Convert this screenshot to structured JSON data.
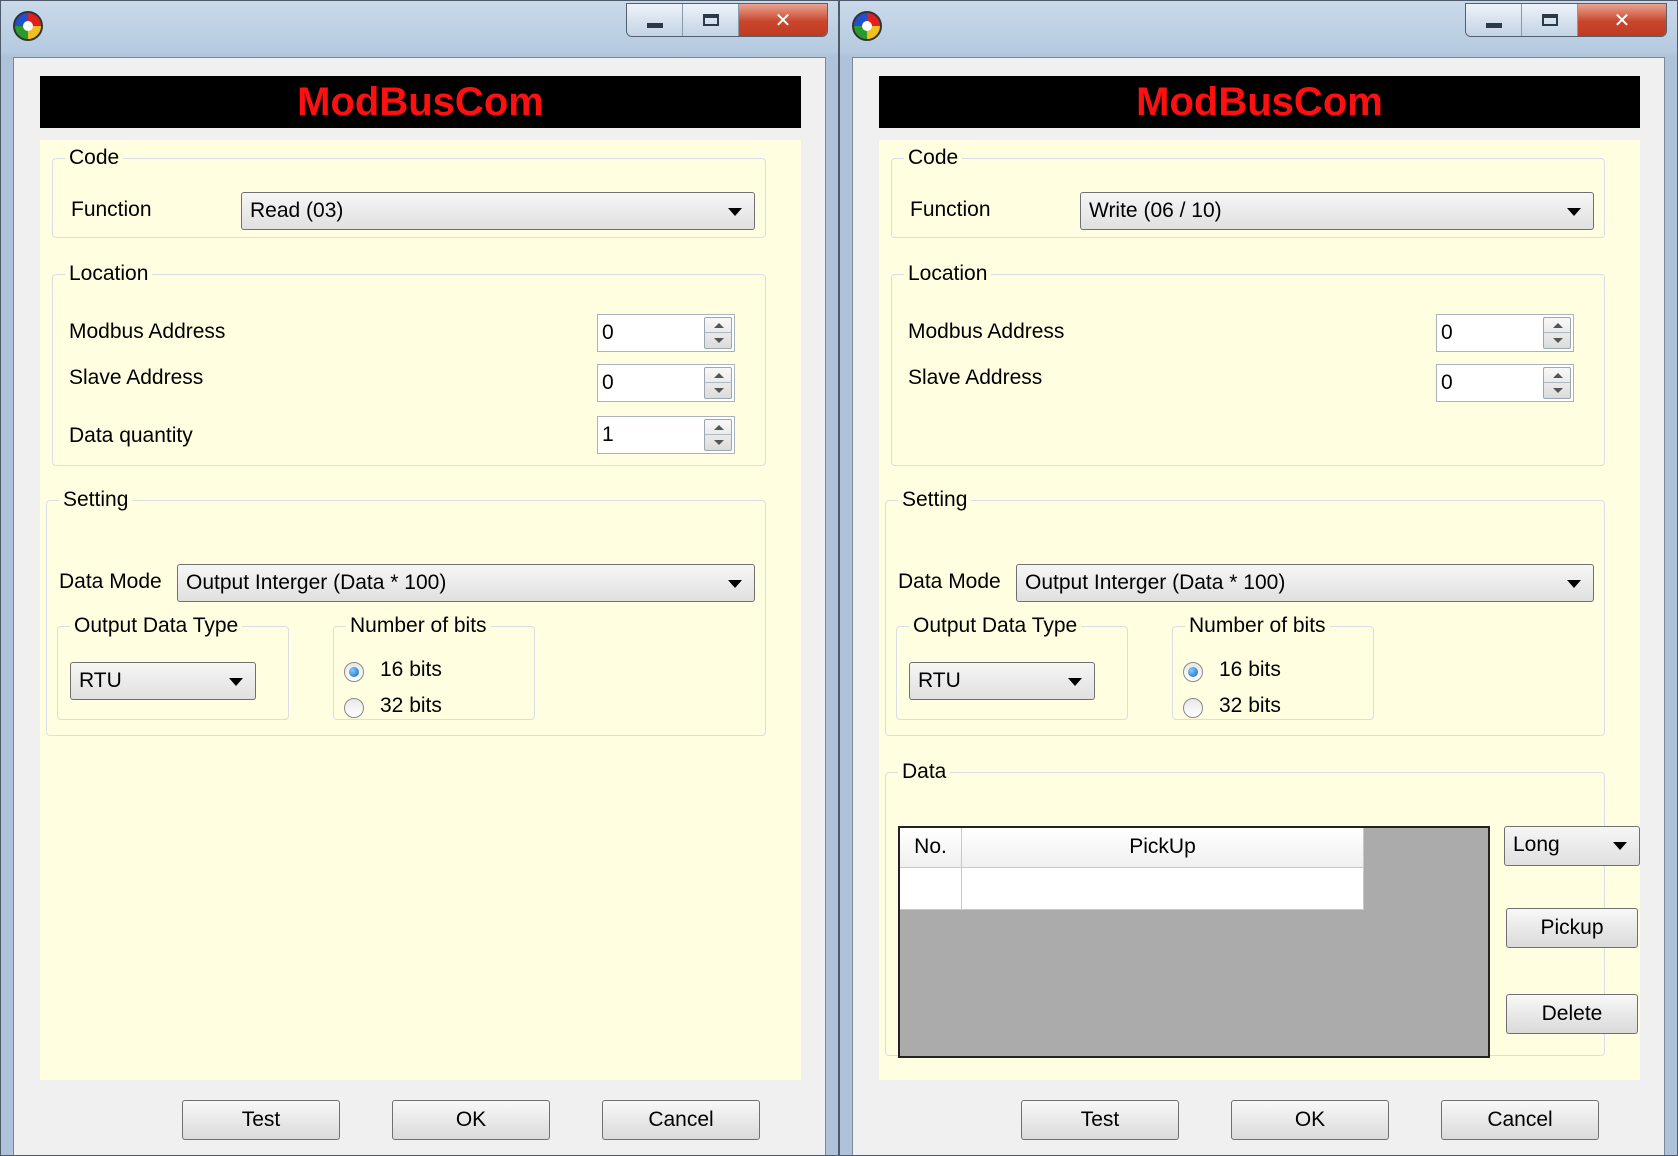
{
  "windows": [
    {
      "banner_title": "ModBusCom",
      "code": {
        "legend": "Code",
        "function_label": "Function",
        "function_value": "Read (03)"
      },
      "location": {
        "legend": "Location",
        "fields": [
          {
            "label": "Modbus Address",
            "value": "0"
          },
          {
            "label": "Slave Address",
            "value": "0"
          },
          {
            "label": "Data quantity",
            "value": "1"
          }
        ]
      },
      "setting": {
        "legend": "Setting",
        "data_mode_label": "Data Mode",
        "data_mode_value": "Output Interger (Data * 100)",
        "output_type_legend": "Output Data Type",
        "output_type_value": "RTU",
        "bits_legend": "Number of bits",
        "bits_options": [
          {
            "label": "16 bits",
            "selected": true
          },
          {
            "label": "32 bits",
            "selected": false
          }
        ]
      },
      "buttons": {
        "test": "Test",
        "ok": "OK",
        "cancel": "Cancel"
      }
    },
    {
      "banner_title": "ModBusCom",
      "code": {
        "legend": "Code",
        "function_label": "Function",
        "function_value": "Write (06 / 10)"
      },
      "location": {
        "legend": "Location",
        "fields": [
          {
            "label": "Modbus Address",
            "value": "0"
          },
          {
            "label": "Slave Address",
            "value": "0"
          }
        ]
      },
      "setting": {
        "legend": "Setting",
        "data_mode_label": "Data Mode",
        "data_mode_value": "Output Interger (Data * 100)",
        "output_type_legend": "Output Data Type",
        "output_type_value": "RTU",
        "bits_legend": "Number of bits",
        "bits_options": [
          {
            "label": "16 bits",
            "selected": true
          },
          {
            "label": "32 bits",
            "selected": false
          }
        ]
      },
      "data": {
        "legend": "Data",
        "columns": [
          "No.",
          "PickUp"
        ],
        "type_value": "Long",
        "pickup_label": "Pickup",
        "delete_label": "Delete"
      },
      "buttons": {
        "test": "Test",
        "ok": "OK",
        "cancel": "Cancel"
      }
    }
  ],
  "colors": {
    "banner_bg": "#000000",
    "banner_text": "#ff1010",
    "panel_bg": "#fffee0",
    "grid_bg": "#ababab"
  }
}
